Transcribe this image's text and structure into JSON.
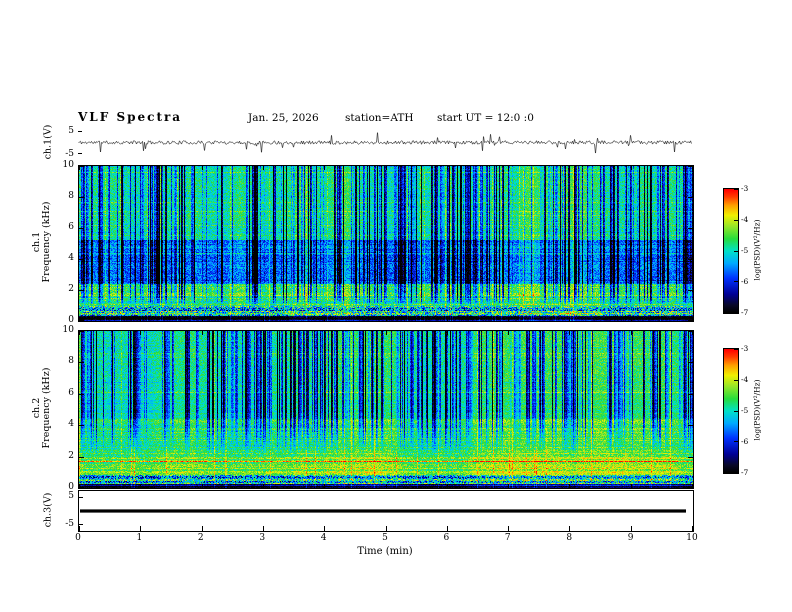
{
  "header": {
    "title": "VLF  Spectra",
    "date": "Jan. 25, 2026",
    "station": "station=ATH",
    "start_ut": "start UT =  12:0 :0"
  },
  "axes": {
    "time_label": "Time (min)",
    "x_tick_labels": [
      "0",
      "1",
      "2",
      "3",
      "4",
      "5",
      "6",
      "7",
      "8",
      "9",
      "10"
    ],
    "freq_tick_labels": [
      "10",
      "8",
      "6",
      "4",
      "2",
      "0"
    ],
    "volt_tick_labels": [
      "5",
      "-5"
    ],
    "colorbar_tick_labels": [
      "-3",
      "-4",
      "-5",
      "-6",
      "-7"
    ],
    "colorbar_label": "log(PSD)(V²/Hz)"
  },
  "panels": {
    "ch1_wave_label": "ch.1(V)",
    "ch1_spec_label_line1": "ch.1",
    "ch1_spec_label_line2": "Frequency (kHz)",
    "ch2_spec_label_line1": "ch.2",
    "ch2_spec_label_line2": "Frequency (kHz)",
    "ch3_wave_label": "ch.3(V)"
  },
  "colormap": [
    [
      0.0,
      [
        0,
        0,
        0
      ]
    ],
    [
      0.06,
      [
        8,
        8,
        40
      ]
    ],
    [
      0.15,
      [
        0,
        0,
        150
      ]
    ],
    [
      0.28,
      [
        0,
        50,
        255
      ]
    ],
    [
      0.4,
      [
        0,
        170,
        255
      ]
    ],
    [
      0.5,
      [
        0,
        225,
        200
      ]
    ],
    [
      0.6,
      [
        40,
        220,
        60
      ]
    ],
    [
      0.7,
      [
        150,
        230,
        40
      ]
    ],
    [
      0.79,
      [
        240,
        240,
        0
      ]
    ],
    [
      0.87,
      [
        255,
        160,
        0
      ]
    ],
    [
      0.94,
      [
        255,
        60,
        0
      ]
    ],
    [
      1.0,
      [
        255,
        0,
        0
      ]
    ]
  ],
  "chart_data": [
    {
      "type": "line",
      "name": "ch1-waveform",
      "ylabel": "ch.1(V)",
      "ylim": [
        -7,
        7
      ],
      "yticks": [
        5,
        -5
      ],
      "x_range": [
        0,
        10
      ],
      "xlabel": "Time (min)",
      "description": "Dense broadband noise fluctuating around 0 V with impulsive spikes up to about ±5 V across the full 10 minutes",
      "seed": 11,
      "base_amplitude": 0.8,
      "spike_probability": 0.035,
      "spike_amplitude": [
        1.5,
        4.6
      ]
    },
    {
      "type": "heatmap",
      "name": "ch1-spectrogram",
      "ylabel": "ch.1 Frequency (kHz)",
      "y_range": [
        0,
        10
      ],
      "yticks": [
        0,
        2,
        4,
        6,
        8,
        10
      ],
      "x_range": [
        0,
        10
      ],
      "value_range": [
        -7,
        -3
      ],
      "colorbar": {
        "label": "log(PSD)(V²/Hz)",
        "ticks": [
          -3,
          -4,
          -5,
          -6,
          -7
        ]
      },
      "description": "VLF spectrogram: green background near -4.8, dark-blue band 2.4-5.2 kHz, bright red/yellow and black horizontal striations below 1 kHz, dense dark vertical dropout stripes above ~1 kHz",
      "seed": 23,
      "bands": [
        {
          "f": [
            0,
            0.3
          ],
          "level": -6.9,
          "noise": 0.5,
          "row_var": 1.2
        },
        {
          "f": [
            0.3,
            0.95
          ],
          "level": -5.1,
          "noise": 2.1,
          "row_var": 2.2
        },
        {
          "f": [
            0.95,
            2.4
          ],
          "level": -4.55,
          "noise": 0.9,
          "row_var": 0.95
        },
        {
          "f": [
            2.4,
            5.2
          ],
          "level": -5.5,
          "noise": 0.85,
          "row_var": 0.55
        },
        {
          "f": [
            5.2,
            10.01
          ],
          "level": -4.8,
          "noise": 0.75,
          "row_var": 0.35
        }
      ],
      "stripes": {
        "probability": 0.32,
        "depth": [
          0.5,
          2.5
        ]
      },
      "stripe_profile": [
        0.9,
        1.7
      ]
    },
    {
      "type": "heatmap",
      "name": "ch2-spectrogram",
      "ylabel": "ch.2 Frequency (kHz)",
      "y_range": [
        0,
        10
      ],
      "yticks": [
        0,
        2,
        4,
        6,
        8,
        10
      ],
      "x_range": [
        0,
        10
      ],
      "value_range": [
        -7,
        -3
      ],
      "colorbar": {
        "label": "log(PSD)(V²/Hz)",
        "ticks": [
          -3,
          -4,
          -5,
          -6,
          -7
        ]
      },
      "description": "VLF spectrogram: yellow/orange horizontal lines 0.8-2.2 kHz over green background, black band below 0.3 kHz, vertical dropout stripes mainly above ~4.5 kHz",
      "seed": 57,
      "bands": [
        {
          "f": [
            0,
            0.28
          ],
          "level": -6.9,
          "noise": 0.5,
          "row_var": 1.4
        },
        {
          "f": [
            0.28,
            0.85
          ],
          "level": -5.0,
          "noise": 2.0,
          "row_var": 2.3
        },
        {
          "f": [
            0.85,
            2.25
          ],
          "level": -4.3,
          "noise": 0.8,
          "row_var": 1.1
        },
        {
          "f": [
            2.25,
            4.4
          ],
          "level": -4.6,
          "noise": 0.75,
          "row_var": 0.8
        },
        {
          "f": [
            4.4,
            6.0
          ],
          "level": -4.9,
          "noise": 0.6,
          "row_var": 0.4
        },
        {
          "f": [
            6.0,
            10.01
          ],
          "level": -4.8,
          "noise": 0.75,
          "row_var": 0.35
        }
      ],
      "stripes": {
        "probability": 0.32,
        "depth": [
          0.5,
          2.5
        ]
      },
      "stripe_profile": [
        2.0,
        4.8
      ]
    },
    {
      "type": "line",
      "name": "ch3-waveform",
      "ylabel": "ch.3(V)",
      "ylim": [
        -7,
        7
      ],
      "yticks": [
        5,
        -5
      ],
      "x_range": [
        0,
        10
      ],
      "description": "Flat heavy black trace at 0 V for the full 10 minutes (no signal)",
      "value": 0
    }
  ]
}
